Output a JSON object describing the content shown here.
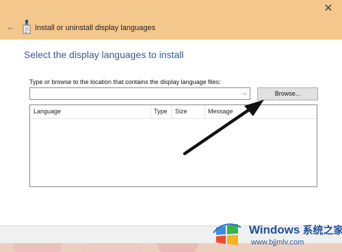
{
  "window": {
    "title": "Install or uninstall display languages",
    "back_icon": "back-arrow-icon",
    "close_icon": "close-icon",
    "accent_color": "#f4c78d"
  },
  "main": {
    "heading": "Select the display languages to install",
    "instruction": "Type or browse to the location that contains the display language files:",
    "path_input": {
      "value": "",
      "placeholder": ""
    },
    "browse_label": "Browse...",
    "list": {
      "columns": [
        "Language",
        "Type",
        "Size",
        "Message"
      ],
      "rows": []
    }
  },
  "watermark": {
    "title": "Windows",
    "title_cn": "系统之家",
    "url": "www.bjjmlv.com"
  }
}
